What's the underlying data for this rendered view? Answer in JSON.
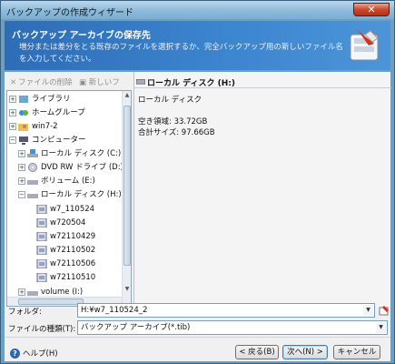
{
  "window": {
    "title": "バックアップの作成ウィザード",
    "close": "✕"
  },
  "header": {
    "title": "バックアップ アーカイブの保存先",
    "description": "増分または差分をとる既存のファイルを選択するか、完全バックアップ用の新しいファイル名を入力してください。"
  },
  "toolbar": {
    "delete_label": "ファイルの削除",
    "new_label": "新しいフ"
  },
  "tree": {
    "items": [
      {
        "label": "ライブラリ"
      },
      {
        "label": "ホームグループ"
      },
      {
        "label": "win7-2"
      },
      {
        "label": "コンピューター"
      },
      {
        "label": "ローカル ディスク (C:)"
      },
      {
        "label": "DVD RW ドライブ (D:)"
      },
      {
        "label": "ボリューム (E:)"
      },
      {
        "label": "ローカル ディスク (H:)"
      },
      {
        "label": "w7_110524"
      },
      {
        "label": "w720504"
      },
      {
        "label": "w72110429"
      },
      {
        "label": "w72110502"
      },
      {
        "label": "w72110506"
      },
      {
        "label": "w72110510"
      },
      {
        "label": "volume (I:)"
      }
    ]
  },
  "info": {
    "name": "ローカル ディスク (H:)",
    "type": "ローカル ディスク",
    "free": "空き領域: 33.72GB",
    "total": "合計サイズ: 97.66GB"
  },
  "folder": {
    "label": "フォルダ:",
    "value": "H:¥w7_110524_2"
  },
  "filetype": {
    "label": "ファイルの種類(T):",
    "value": "バックアップ アーカイブ(*.tib)"
  },
  "buttons": {
    "help": "ヘルプ(H)",
    "back": "< 戻る(B)",
    "next": "次へ(N) >",
    "cancel": "キャンセル"
  }
}
